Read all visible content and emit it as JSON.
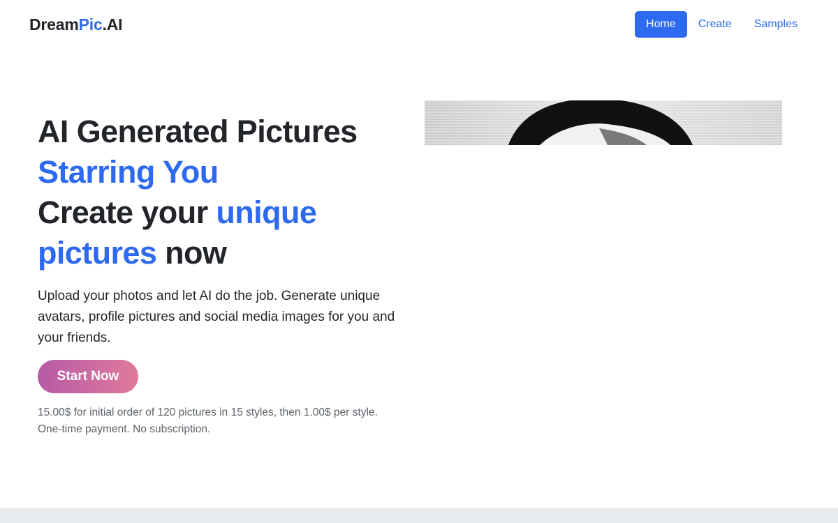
{
  "brand": {
    "part1": "Dream",
    "part2": "Pic",
    "part3": ".AI"
  },
  "nav": {
    "home": "Home",
    "create": "Create",
    "samples": "Samples"
  },
  "hero": {
    "line1": "AI Generated Pictures",
    "line2": "Starring You",
    "line3a": "Create your ",
    "line3b": "unique",
    "line4a": "pictures",
    "line4b": " now",
    "lead": "Upload your photos and let AI do the job. Generate unique avatars, profile pictures and social media images for you and your friends.",
    "cta": "Start Now",
    "price_line1": "15.00$ for initial order of 120 pictures in 15 styles, then 1.00$ per style.",
    "price_line2": "One-time payment. No subscription."
  },
  "colors": {
    "accent": "#2e6af0",
    "text": "#212529",
    "muted": "#5c6369",
    "cta_start": "#b65aa6",
    "cta_end": "#e07a9c"
  }
}
